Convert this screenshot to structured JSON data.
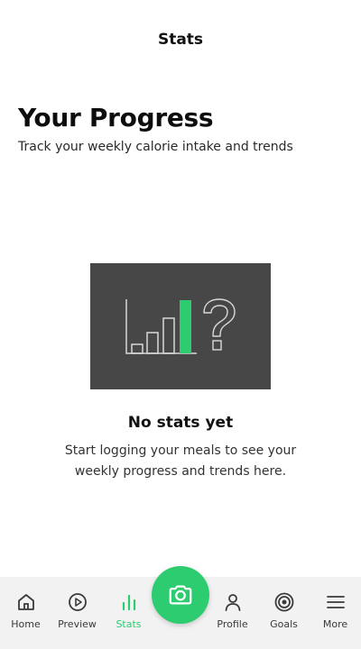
{
  "header": {
    "title": "Stats"
  },
  "intro": {
    "heading": "Your Progress",
    "subheading": "Track your weekly calorie intake and trends"
  },
  "empty_state": {
    "title": "No stats yet",
    "message": "Start logging your meals to see your weekly progress and trends here.",
    "illustration_icon": "bar-chart-question-icon"
  },
  "colors": {
    "accent": "#2ecc71",
    "illustration_bg": "#474747",
    "nav_bg": "#f2f2f2"
  },
  "bottom_nav": {
    "items": [
      {
        "label": "Home",
        "icon": "home-icon"
      },
      {
        "label": "Preview",
        "icon": "play-circle-icon"
      },
      {
        "label": "Stats",
        "icon": "bar-chart-icon",
        "active": true
      },
      {
        "label": "Profile",
        "icon": "person-icon"
      },
      {
        "label": "Goals",
        "icon": "target-icon"
      },
      {
        "label": "More",
        "icon": "menu-icon"
      }
    ],
    "center_action": {
      "icon": "camera-icon"
    }
  }
}
